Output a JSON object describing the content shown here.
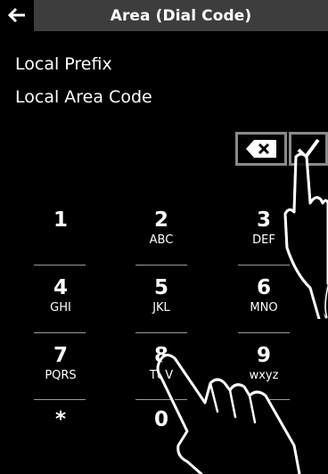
{
  "header": {
    "title": "Area (Dial Code)",
    "back_icon": "arrow-left-icon"
  },
  "fields": {
    "local_prefix": "Local Prefix",
    "local_area_code": "Local Area Code"
  },
  "controls": {
    "backspace_icon": "backspace-icon",
    "confirm_icon": "checkmark-icon"
  },
  "keypad": {
    "keys": [
      {
        "digit": "1",
        "letters": ""
      },
      {
        "digit": "2",
        "letters": "ABC"
      },
      {
        "digit": "3",
        "letters": "DEF"
      },
      {
        "digit": "4",
        "letters": "GHI"
      },
      {
        "digit": "5",
        "letters": "JKL"
      },
      {
        "digit": "6",
        "letters": "MNO"
      },
      {
        "digit": "7",
        "letters": "PQRS"
      },
      {
        "digit": "8",
        "letters": "TUV"
      },
      {
        "digit": "9",
        "letters": "wxyz"
      },
      {
        "digit": "*",
        "letters": ""
      },
      {
        "digit": "0",
        "letters": ""
      },
      {
        "digit": "#",
        "letters": ""
      }
    ]
  },
  "colors": {
    "background": "#000000",
    "title_bar": "#3d3d3d",
    "control_border": "#8a8a8a",
    "text": "#ffffff"
  }
}
